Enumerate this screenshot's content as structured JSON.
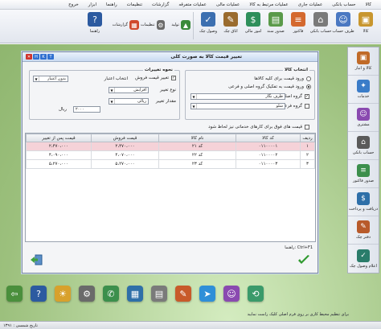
{
  "menu": [
    "کالا",
    "حساب بانکی",
    "عملیات جاری",
    "عملیات مرتبط به کالا",
    "عملیات مالی",
    "عملیات متفرقه",
    "گزارشات",
    "تنظیمات",
    "راهنما",
    "ابزار",
    "خروج"
  ],
  "toolbar": {
    "items": [
      {
        "label": "کالا",
        "icon": "box-icon",
        "color": "#c8962e"
      },
      {
        "label": "طرف حساب",
        "icon": "person-icon",
        "color": "#4a78c2"
      },
      {
        "label": "حساب بانکی",
        "icon": "bank-icon",
        "color": "#7a7a7a"
      },
      {
        "label": "فاکتور",
        "icon": "invoice-icon",
        "color": "#d4692f"
      },
      {
        "label": "صدور سند",
        "icon": "document-icon",
        "color": "#5a9a4a"
      },
      {
        "label": "امور مالی",
        "icon": "money-icon",
        "color": "#2e8f5b"
      },
      {
        "label": "اتاق چک",
        "icon": "cheque-icon",
        "color": "#9a6b2e"
      },
      {
        "label": "وصول چک",
        "icon": "check-icon",
        "color": "#3c6fb0"
      }
    ],
    "right_items": [
      {
        "label": "تولید",
        "icon": "factory-icon",
        "color": "#3a8a3a"
      },
      {
        "label": "تنظیمات",
        "icon": "settings-icon",
        "color": "#6a6a6a"
      },
      {
        "label": "گزارشات",
        "icon": "report-icon",
        "color": "#d0482c"
      },
      {
        "label": "راهنما",
        "icon": "help-icon",
        "color": "#2c5aa0"
      }
    ]
  },
  "sidebar": [
    {
      "label": "کالا و انبار",
      "icon": "warehouse-icon",
      "color": "#c06a28"
    },
    {
      "label": "خدمات",
      "icon": "service-icon",
      "color": "#3a7cc8"
    },
    {
      "label": "مشتری",
      "icon": "customer-icon",
      "color": "#8a4ab0"
    },
    {
      "label": "حساب بانکی",
      "icon": "bank-icon",
      "color": "#5a5a5a"
    },
    {
      "label": "صدور فاکتور",
      "icon": "invoice-icon",
      "color": "#3c8f4c"
    },
    {
      "label": "دریافت و پرداخت",
      "icon": "payment-icon",
      "color": "#2e6fa8"
    },
    {
      "label": "دفتر چک",
      "icon": "chequebook-icon",
      "color": "#b85a2a"
    },
    {
      "label": "اعلام وصول چک",
      "icon": "cheque-receive-icon",
      "color": "#2a7c6a"
    }
  ],
  "dialog": {
    "title": "تغییر قیمت کالا به صورت کلی",
    "controls": [
      "H",
      "K",
      "T"
    ],
    "select_group": {
      "title": "انتخاب کالا",
      "opt_all": "ورود قیمت برای کلیه کالاها",
      "opt_group": "ورود قیمت به تفکیک گروه اصلی و فرعی",
      "main_group_label": "گروه اصلی",
      "main_group_value": "ظرف نگار",
      "sub_group_label": "گروه فرعی",
      "sub_group_value": "شلو"
    },
    "change_group": {
      "title": "نحوه تغییرات",
      "price_change_label": "تغییر قیمت فروش",
      "credit_label": "انتخاب اعتبار",
      "credit_value": "بدون اعتبار",
      "change_type_label": "نوع تغییر",
      "change_type_value": "افزایش",
      "amount_label": "مقدار تغییر",
      "amount_type_value": "ریالی",
      "amount_value": "۲۰۰۰",
      "currency": "ریال"
    },
    "services_check": "قیمت های فوق برای کارهای خدماتی نیز لحاظ شود",
    "table": {
      "columns": [
        "ردیف",
        "کد کالا",
        "نام کالا",
        "قیمت فروش",
        "قیمت پس از تغییر"
      ],
      "rows": [
        [
          "۱",
          "۰۱۱۰۰۰۰۱",
          "کد ۲۱",
          "۲،۴۷۰،۰۰۰",
          "۲،۴۷۰،۰۰۰"
        ],
        [
          "۲",
          "۰۱۱۰۰۰۰۲",
          "کد ۲۲",
          "۴،۰۷۰،۰۰۰",
          "۴،۰۹۰،۰۰۰"
        ],
        [
          "۳",
          "۰۱۱۰۰۰۰۳",
          "کد ۲۳",
          "۵،۲۷۰،۰۰۰",
          "۵،۲۷۰،۰۰۰"
        ]
      ]
    },
    "status": "راهنما: Ctrl+F1"
  },
  "bottom_text": "برای تنظیم محیط کاری بر روی فرم اصلی کلیک راست نمایید",
  "status_bar": "تاریخ شمسی : ۱۳۹۱"
}
